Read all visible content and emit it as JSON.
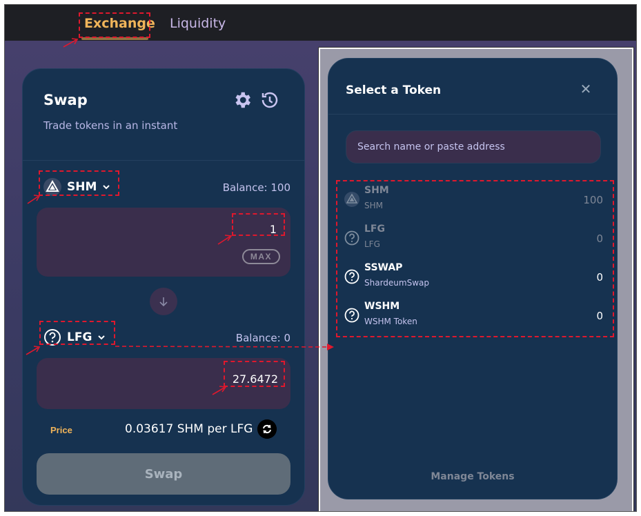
{
  "nav": {
    "tabs": [
      {
        "label": "Exchange"
      },
      {
        "label": "Liquidity"
      }
    ]
  },
  "swap": {
    "title": "Swap",
    "subtitle": "Trade tokens in an instant",
    "from": {
      "symbol": "SHM",
      "balance": "Balance: 100",
      "amount": "1",
      "max_label": "MAX"
    },
    "to": {
      "symbol": "LFG",
      "balance": "Balance: 0",
      "amount": "27.6472"
    },
    "price_label": "Price",
    "price_value": "0.03617 SHM per LFG",
    "button_label": "Swap"
  },
  "token_modal": {
    "title": "Select a Token",
    "search_placeholder": "Search name or paste address",
    "tokens": [
      {
        "symbol": "SHM",
        "name": "SHM",
        "balance": "100",
        "icon": "shardeum-logo-icon",
        "state": "disabled"
      },
      {
        "symbol": "LFG",
        "name": "LFG",
        "balance": "0",
        "icon": "question-circle-icon",
        "state": "disabled"
      },
      {
        "symbol": "SSWAP",
        "name": "ShardeumSwap",
        "balance": "0",
        "icon": "question-circle-icon",
        "state": "active"
      },
      {
        "symbol": "WSHM",
        "name": "WSHM Token",
        "balance": "0",
        "icon": "question-circle-icon",
        "state": "active"
      }
    ],
    "manage_label": "Manage Tokens"
  },
  "colors": {
    "accent": "#f0b45a",
    "card": "#163250",
    "input": "#3a2e4c",
    "annotation": "#e0182d"
  }
}
